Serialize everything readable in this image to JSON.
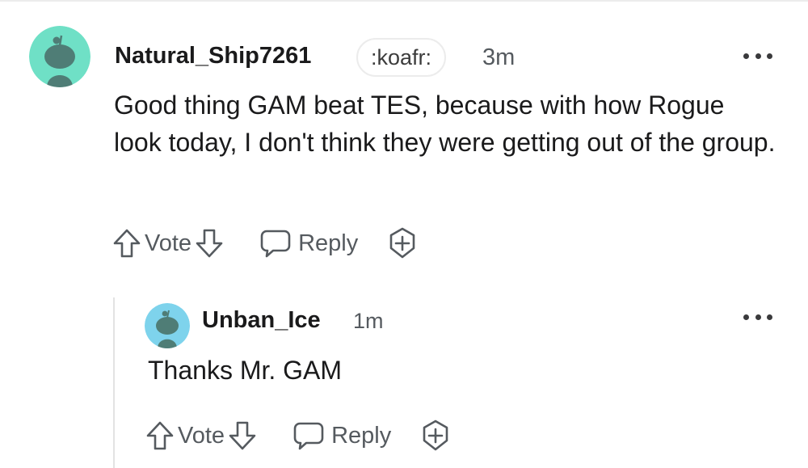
{
  "comments": [
    {
      "username": "Natural_Ship7261",
      "flair": ":koafr:",
      "time": "3m",
      "body": "Good thing GAM beat TES, because with how Rogue look today, I don't think they were getting out of the group.",
      "actions": {
        "vote_label": "Vote",
        "reply_label": "Reply"
      },
      "avatar_color": "#6fe0c6"
    },
    {
      "username": "Unban_Ice",
      "time": "1m",
      "body": "Thanks Mr. GAM",
      "actions": {
        "vote_label": "Vote",
        "reply_label": "Reply"
      },
      "avatar_color": "#7ed3ec"
    }
  ],
  "colors": {
    "text_primary": "#1a1a1b",
    "text_secondary": "#555a5f",
    "divider": "#ececec",
    "avatar_figure": "#4f7d76"
  },
  "icons": [
    "snoo-avatar-icon",
    "more-options-icon",
    "upvote-arrow-icon",
    "downvote-arrow-icon",
    "reply-bubble-icon",
    "award-plus-icon"
  ]
}
